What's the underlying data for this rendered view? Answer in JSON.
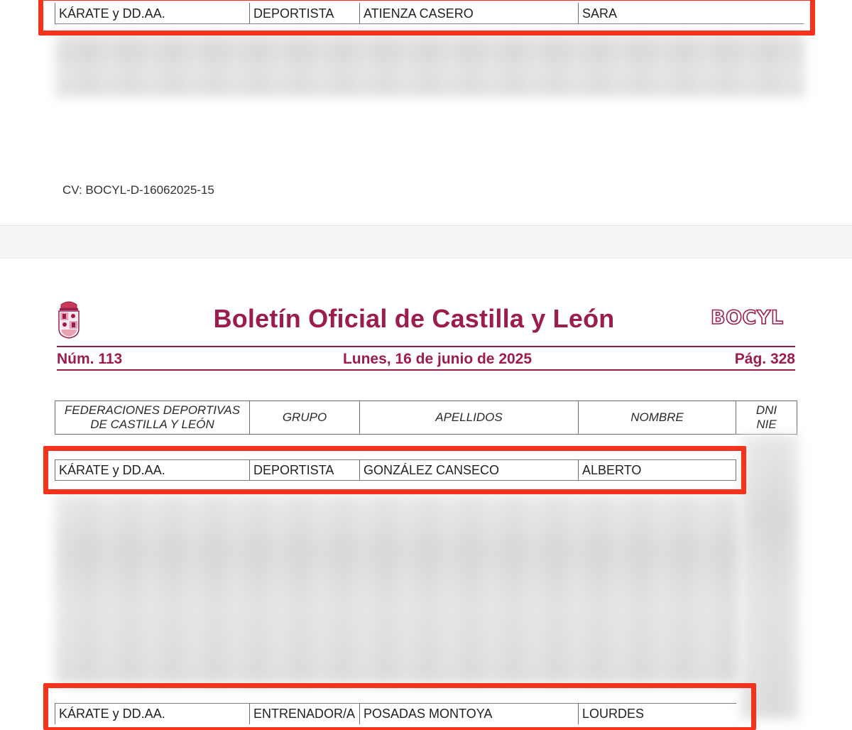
{
  "page1": {
    "row": {
      "federacion": "KÁRATE y DD.AA.",
      "grupo": "DEPORTISTA",
      "apellidos": "ATIENZA CASERO",
      "nombre": "SARA"
    },
    "cv": "CV: BOCYL-D-16062025-15"
  },
  "page2": {
    "title": "Boletín Oficial de Castilla y León",
    "logo_text": "BOCYL",
    "numero": "Núm. 113",
    "fecha": "Lunes, 16 de junio de 2025",
    "pagina": "Pág. 328",
    "headers": {
      "federacion_line1": "FEDERACIONES DEPORTIVAS",
      "federacion_line2": "DE CASTILLA Y LEÓN",
      "grupo": "GRUPO",
      "apellidos": "APELLIDOS",
      "nombre": "NOMBRE",
      "dni_line1": "DNI",
      "dni_line2": "NIE"
    },
    "row1": {
      "federacion": "KÁRATE y DD.AA.",
      "grupo": "DEPORTISTA",
      "apellidos": "GONZÁLEZ CANSECO",
      "nombre": "ALBERTO"
    },
    "row2": {
      "federacion": "KÁRATE y DD.AA.",
      "grupo": "ENTRENADOR/A",
      "apellidos": "POSADAS MONTOYA",
      "nombre": "LOURDES"
    }
  },
  "colors": {
    "brand": "#9c1c4e",
    "highlight": "#f5331c"
  }
}
